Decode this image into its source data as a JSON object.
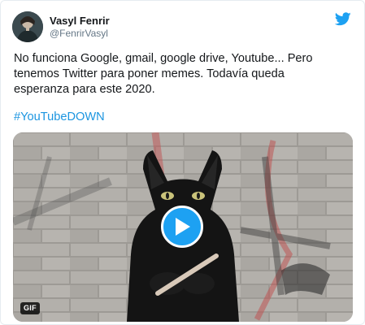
{
  "user": {
    "display_name": "Vasyl Fenrir",
    "handle": "@FenrirVasyl",
    "avatar_icon": "avatar-photo"
  },
  "logo_icon": "twitter-bird-icon",
  "tweet": {
    "text": "No funciona Google, gmail, google drive, Youtube... Pero\ntenemos Twitter para poner memes. Todavía queda\nesperanza para este 2020.",
    "hashtag": "#YouTubeDOWN"
  },
  "media": {
    "badge": "GIF",
    "play_icon": "play-icon",
    "description_icon": "black-cat-gif"
  },
  "colors": {
    "brand": "#1da1f2",
    "link": "#1b95e0",
    "text": "#14171a",
    "muted": "#657786"
  }
}
